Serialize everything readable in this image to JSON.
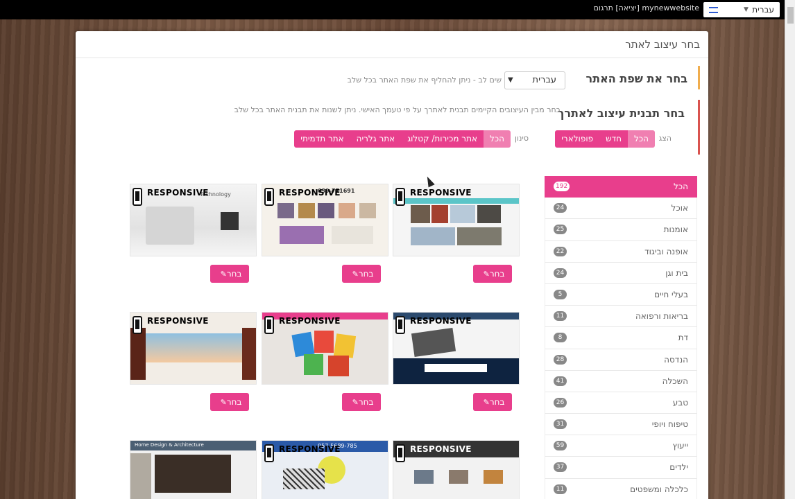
{
  "topbar": {
    "language_label": "עברית",
    "site_info": "mynewwebsite [יציאה] תרגום"
  },
  "modal": {
    "title": "בחר עיצוב לאתר"
  },
  "step1": {
    "title": "בחר את שפת האתר",
    "selected_language": "עברית",
    "note": "שים לב - ניתן להחליף את שפת האתר בכל שלב"
  },
  "step2": {
    "title": "בחר תבנית עיצוב לאתרך",
    "note": "בחר מבין העיצובים הקיימים תבנית לאתרך על פי טעמך האישי. ניתן לשנות את תבנית האתר בכל שלב",
    "show_label": "הצג",
    "filter_label": "סינון",
    "show_buttons": [
      "הכל",
      "חדש",
      "פופולארי"
    ],
    "filter_buttons": [
      "הכל",
      "אתר מכירות/ קטלוג",
      "אתר גלריה",
      "אתר תדמיתי"
    ]
  },
  "categories": [
    {
      "label": "הכל",
      "count": "192"
    },
    {
      "label": "אוכל",
      "count": "24"
    },
    {
      "label": "אומנות",
      "count": "25"
    },
    {
      "label": "אופנה וביגוד",
      "count": "22"
    },
    {
      "label": "בית וגן",
      "count": "24"
    },
    {
      "label": "בעלי חיים",
      "count": "5"
    },
    {
      "label": "בריאות ורפואה",
      "count": "11"
    },
    {
      "label": "דת",
      "count": "8"
    },
    {
      "label": "הנדסה",
      "count": "28"
    },
    {
      "label": "השכלה",
      "count": "41"
    },
    {
      "label": "טבע",
      "count": "26"
    },
    {
      "label": "טיפוח ויופי",
      "count": "31"
    },
    {
      "label": "ייעוץ",
      "count": "59"
    },
    {
      "label": "ילדים",
      "count": "37"
    },
    {
      "label": "כלכלה ומשפטים",
      "count": "11"
    }
  ],
  "templates": {
    "responsive_label": "RESPONSIVE",
    "choose_label": "בחר",
    "pencil_icon": "pencil-icon",
    "card_texts": {
      "technology": "Technology",
      "phone": "039-771691",
      "home_design": "Home Design & Architecture",
      "phone2": "057-5689-785"
    }
  },
  "colors": {
    "accent": "#e83e8c",
    "accent_light": "#f07fb1",
    "step1_border": "#f0ad4e",
    "step2_border": "#d9534f"
  }
}
